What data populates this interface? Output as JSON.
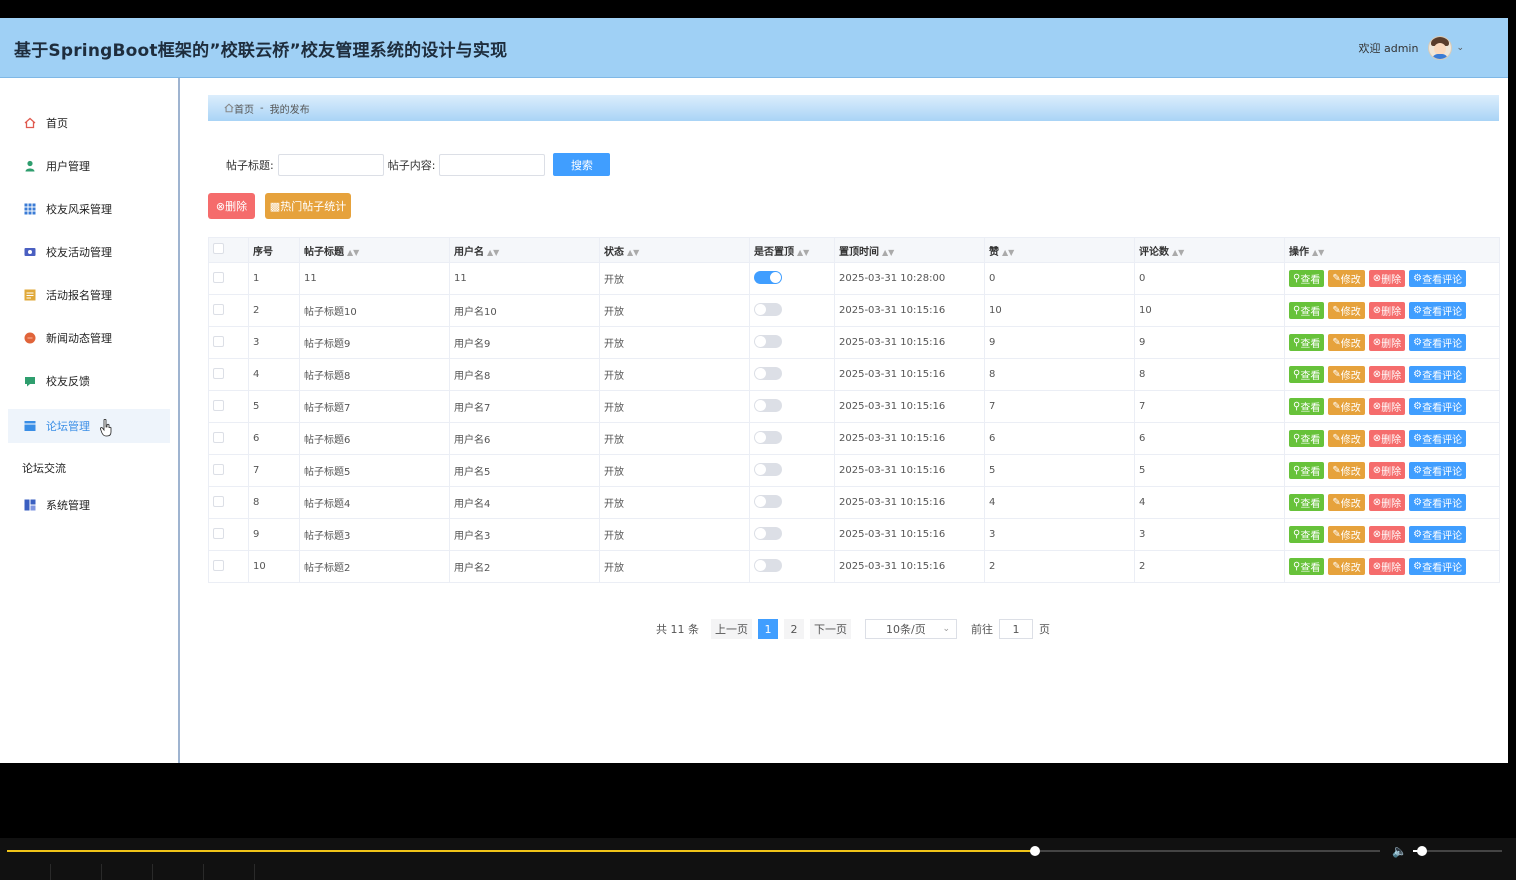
{
  "header": {
    "title": "基于SpringBoot框架的”校联云桥”校友管理系统的设计与实现",
    "welcome": "欢迎 admin"
  },
  "sidebar": {
    "items": [
      {
        "label": "首页",
        "icon": "home-icon",
        "color": "#e05a4f"
      },
      {
        "label": "用户管理",
        "icon": "user-icon",
        "color": "#2f9e6e"
      },
      {
        "label": "校友风采管理",
        "icon": "grid-icon",
        "color": "#3a7bd5"
      },
      {
        "label": "校友活动管理",
        "icon": "activity-icon",
        "color": "#4a5fc1"
      },
      {
        "label": "活动报名管理",
        "icon": "signup-icon",
        "color": "#e0a93a"
      },
      {
        "label": "新闻动态管理",
        "icon": "news-icon",
        "color": "#e0643a"
      },
      {
        "label": "校友反馈",
        "icon": "feedback-icon",
        "color": "#2f9e6e"
      },
      {
        "label": "论坛管理",
        "icon": "forum-icon",
        "color": "#3a8ee6"
      }
    ],
    "forum_group": "论坛交流",
    "system": {
      "label": "系统管理",
      "icon": "system-icon",
      "color": "#3a5fc1"
    }
  },
  "breadcrumb": {
    "home": "首页",
    "current": "我的发布"
  },
  "search": {
    "title_label": "帖子标题:",
    "content_label": "帖子内容:",
    "button": "搜索"
  },
  "actions": {
    "delete": "删除",
    "stats": "热门帖子统计"
  },
  "table": {
    "columns": [
      "序号",
      "帖子标题",
      "用户名",
      "状态",
      "是否置顶",
      "置顶时间",
      "赞",
      "评论数",
      "操作"
    ],
    "op_labels": {
      "view": "查看",
      "edit": "修改",
      "delete": "删除",
      "comments": "查看评论"
    },
    "rows": [
      {
        "no": "1",
        "title": "11",
        "user": "11",
        "status": "开放",
        "top": true,
        "time": "2025-03-31 10:28:00",
        "likes": "0",
        "comments": "0"
      },
      {
        "no": "2",
        "title": "帖子标题10",
        "user": "用户名10",
        "status": "开放",
        "top": false,
        "time": "2025-03-31 10:15:16",
        "likes": "10",
        "comments": "10"
      },
      {
        "no": "3",
        "title": "帖子标题9",
        "user": "用户名9",
        "status": "开放",
        "top": false,
        "time": "2025-03-31 10:15:16",
        "likes": "9",
        "comments": "9"
      },
      {
        "no": "4",
        "title": "帖子标题8",
        "user": "用户名8",
        "status": "开放",
        "top": false,
        "time": "2025-03-31 10:15:16",
        "likes": "8",
        "comments": "8"
      },
      {
        "no": "5",
        "title": "帖子标题7",
        "user": "用户名7",
        "status": "开放",
        "top": false,
        "time": "2025-03-31 10:15:16",
        "likes": "7",
        "comments": "7"
      },
      {
        "no": "6",
        "title": "帖子标题6",
        "user": "用户名6",
        "status": "开放",
        "top": false,
        "time": "2025-03-31 10:15:16",
        "likes": "6",
        "comments": "6"
      },
      {
        "no": "7",
        "title": "帖子标题5",
        "user": "用户名5",
        "status": "开放",
        "top": false,
        "time": "2025-03-31 10:15:16",
        "likes": "5",
        "comments": "5"
      },
      {
        "no": "8",
        "title": "帖子标题4",
        "user": "用户名4",
        "status": "开放",
        "top": false,
        "time": "2025-03-31 10:15:16",
        "likes": "4",
        "comments": "4"
      },
      {
        "no": "9",
        "title": "帖子标题3",
        "user": "用户名3",
        "status": "开放",
        "top": false,
        "time": "2025-03-31 10:15:16",
        "likes": "3",
        "comments": "3"
      },
      {
        "no": "10",
        "title": "帖子标题2",
        "user": "用户名2",
        "status": "开放",
        "top": false,
        "time": "2025-03-31 10:15:16",
        "likes": "2",
        "comments": "2"
      }
    ]
  },
  "pagination": {
    "total": "共 11 条",
    "prev": "上一页",
    "pages": [
      "1",
      "2"
    ],
    "current": "1",
    "next": "下一页",
    "page_size": "10条/页",
    "goto_label": "前往",
    "goto_value": "1",
    "page_suffix": "页"
  },
  "player": {
    "progress": 0.749,
    "volume": 0.1
  }
}
